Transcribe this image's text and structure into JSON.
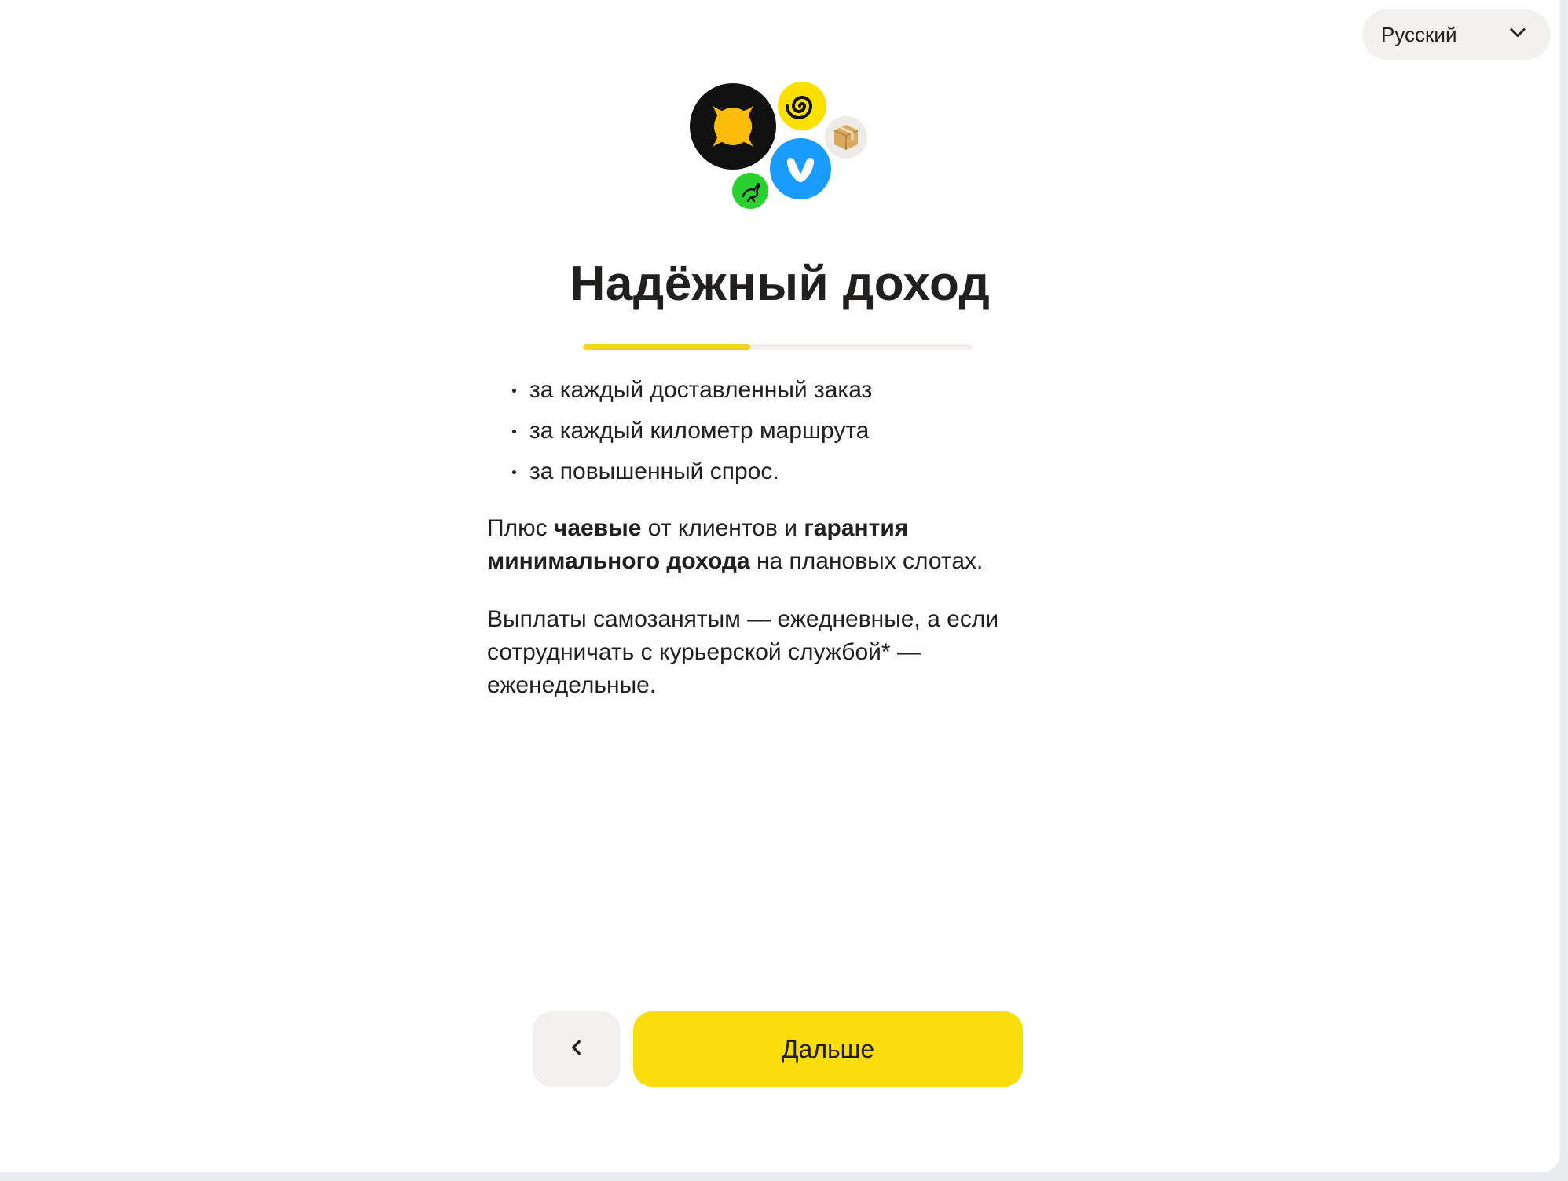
{
  "language_select": {
    "value": "Русский",
    "icon": "chevron-down-icon"
  },
  "logos": [
    "yandex-eats-logo",
    "spiral-logo",
    "parcel-box-logo",
    "check-v-logo",
    "ostrich-logo"
  ],
  "title": "Надёжный доход",
  "progress": {
    "fraction": 0.43,
    "colors": {
      "fill": "#f5d51f",
      "track": "#f0efed"
    }
  },
  "bullets": [
    "за каждый доставленный заказ",
    "за каждый километр маршрута",
    "за повышенный спрос."
  ],
  "paragraph1": {
    "p1": "Плюс ",
    "b1": "чаевые",
    "p2": " от клиентов и ",
    "b2": "гарантия минимального дохода",
    "p3": " на плановых слотах."
  },
  "paragraph2": "Выплаты самозанятым — ежедневные, а если сотрудничать с курьерской службой* — еженедельные.",
  "buttons": {
    "back_icon": "chevron-left-icon",
    "next_label": "Дальше"
  },
  "colors": {
    "accent": "#fadd0a",
    "secondary_button": "#f2f1ef",
    "text": "#21201f"
  }
}
